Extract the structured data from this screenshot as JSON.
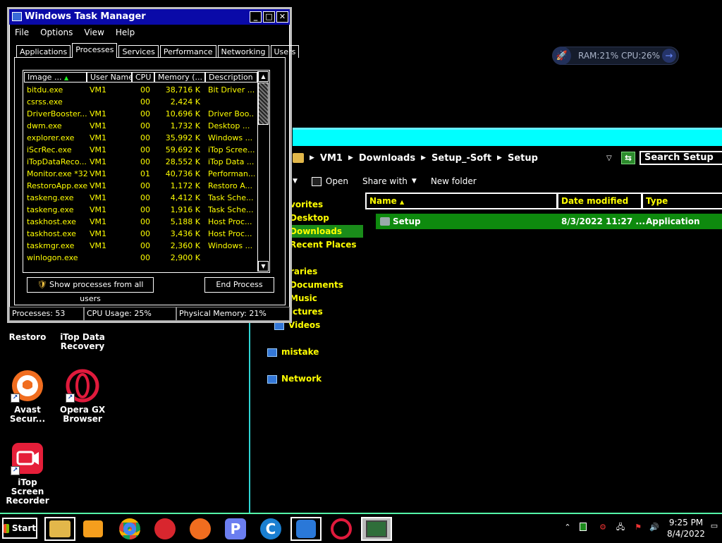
{
  "desktop": {
    "icons": [
      {
        "label": "Restoro"
      },
      {
        "label": "iTop Data Recovery"
      },
      {
        "label": "Avast Secur..."
      },
      {
        "label": "Opera GX Browser"
      },
      {
        "label": "iTop Screen Recorder"
      }
    ],
    "gadget": {
      "text": "RAM:21%   CPU:26%"
    }
  },
  "explorer": {
    "address": {
      "crumbs": [
        "VM1",
        "Downloads",
        "Setup_-Soft",
        "Setup"
      ]
    },
    "search_placeholder": "Search Setup",
    "toolbar": {
      "open": "Open",
      "share_with": "Share with",
      "new_folder": "New folder"
    },
    "nav": [
      {
        "label": "vorites"
      },
      {
        "label": "Desktop"
      },
      {
        "label": "Downloads"
      },
      {
        "label": "Recent Places"
      },
      {
        "label": "raries"
      },
      {
        "label": "Documents"
      },
      {
        "label": "Music"
      },
      {
        "label": "ictures"
      },
      {
        "label": "Videos"
      },
      {
        "label": "mistake"
      },
      {
        "label": "Network"
      }
    ],
    "columns": {
      "name": "Name",
      "date": "Date modified",
      "type": "Type"
    },
    "files": [
      {
        "name": "Setup",
        "date": "8/3/2022 11:27 ...",
        "type": "Application"
      }
    ]
  },
  "taskmgr": {
    "title": "Windows Task Manager",
    "menu": [
      "File",
      "Options",
      "View",
      "Help"
    ],
    "tabs": [
      "Applications",
      "Processes",
      "Services",
      "Performance",
      "Networking",
      "Users"
    ],
    "active_tab": "Processes",
    "columns": {
      "image": "Image ...",
      "user": "User Name",
      "cpu": "CPU",
      "memory": "Memory (...",
      "description": "Description"
    },
    "processes": [
      {
        "image": "bitdu.exe",
        "user": "VM1",
        "cpu": "00",
        "memory": "38,716 K",
        "description": "Bit Driver ..."
      },
      {
        "image": "csrss.exe",
        "user": "",
        "cpu": "00",
        "memory": "2,424 K",
        "description": ""
      },
      {
        "image": "DriverBooster....",
        "user": "VM1",
        "cpu": "00",
        "memory": "10,696 K",
        "description": "Driver Boo..."
      },
      {
        "image": "dwm.exe",
        "user": "VM1",
        "cpu": "00",
        "memory": "1,732 K",
        "description": "Desktop ..."
      },
      {
        "image": "explorer.exe",
        "user": "VM1",
        "cpu": "00",
        "memory": "35,992 K",
        "description": "Windows ..."
      },
      {
        "image": "iScrRec.exe",
        "user": "VM1",
        "cpu": "00",
        "memory": "59,692 K",
        "description": "iTop Scree..."
      },
      {
        "image": "iTopDataReco...",
        "user": "VM1",
        "cpu": "00",
        "memory": "28,552 K",
        "description": "iTop Data ..."
      },
      {
        "image": "Monitor.exe *32",
        "user": "VM1",
        "cpu": "01",
        "memory": "40,736 K",
        "description": "Performan..."
      },
      {
        "image": "RestoroApp.exe",
        "user": "VM1",
        "cpu": "00",
        "memory": "1,172 K",
        "description": "Restoro A..."
      },
      {
        "image": "taskeng.exe",
        "user": "VM1",
        "cpu": "00",
        "memory": "4,412 K",
        "description": "Task Sche..."
      },
      {
        "image": "taskeng.exe",
        "user": "VM1",
        "cpu": "00",
        "memory": "1,916 K",
        "description": "Task Sche..."
      },
      {
        "image": "taskhost.exe",
        "user": "VM1",
        "cpu": "00",
        "memory": "5,188 K",
        "description": "Host Proc..."
      },
      {
        "image": "taskhost.exe",
        "user": "VM1",
        "cpu": "00",
        "memory": "3,436 K",
        "description": "Host Proc..."
      },
      {
        "image": "taskmgr.exe",
        "user": "VM1",
        "cpu": "00",
        "memory": "2,360 K",
        "description": "Windows ..."
      },
      {
        "image": "winlogon.exe",
        "user": "",
        "cpu": "00",
        "memory": "2,900 K",
        "description": ""
      }
    ],
    "show_all_label": "Show processes from all users",
    "end_process_label": "End Process",
    "status": {
      "processes": "Processes: 53",
      "cpu": "CPU Usage: 25%",
      "memory": "Physical Memory: 21%"
    }
  },
  "taskbar": {
    "start_label": "Start",
    "apps": [
      "file-explorer-icon",
      "media-player-icon",
      "chrome-icon",
      "driver-booster-icon",
      "avast-icon",
      "p-app-icon",
      "ccleaner-icon",
      "itop-data-recovery-icon",
      "opera-icon",
      "task-manager-icon"
    ],
    "clock": {
      "time": "9:25 PM",
      "date": "8/4/2022"
    }
  }
}
